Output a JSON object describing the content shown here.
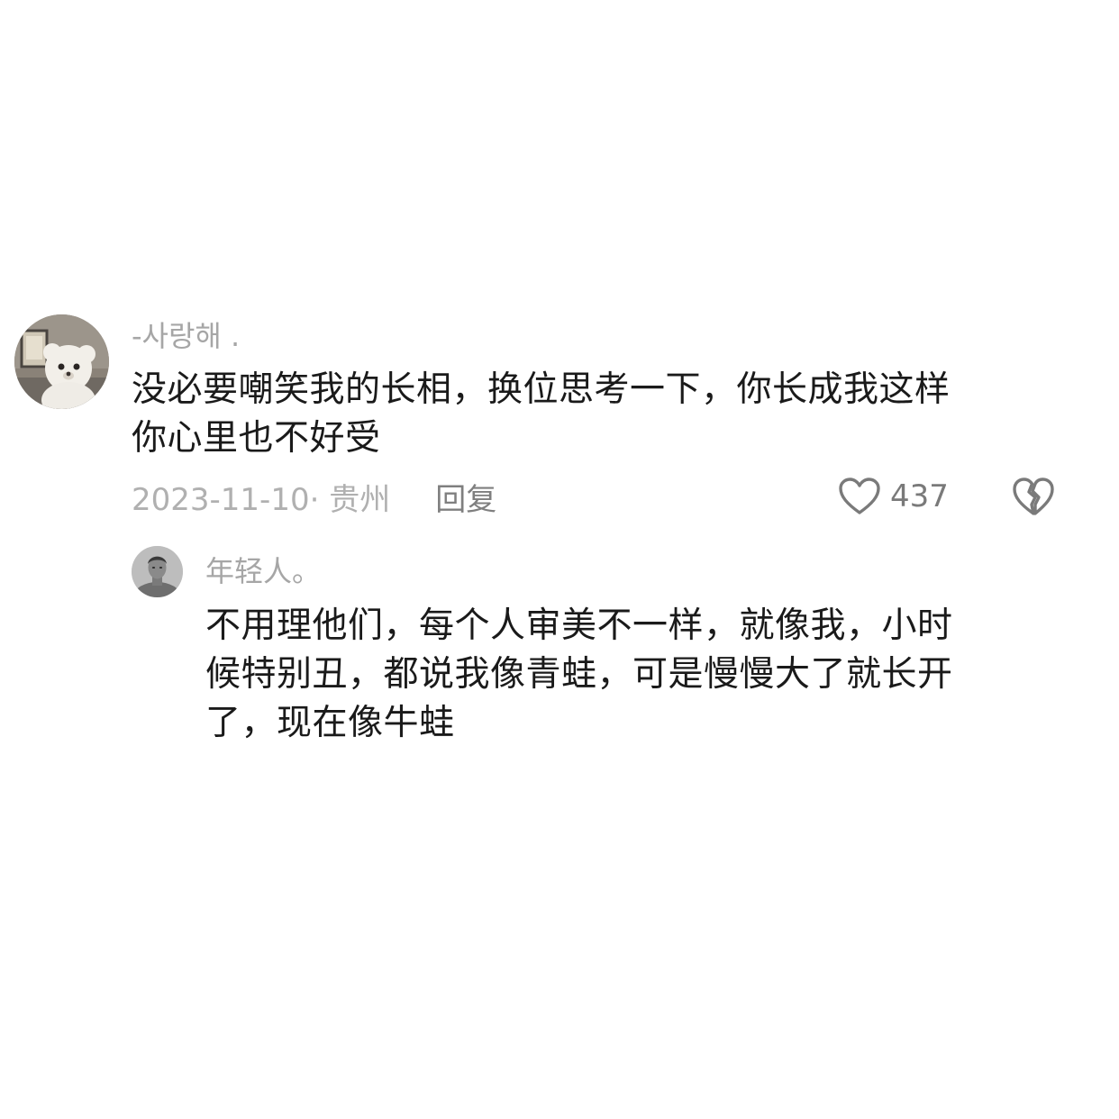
{
  "comment": {
    "avatar_icon": "teddy-bear-avatar",
    "username": "-사랑해 .",
    "lines": [
      "没必要嘲笑我的长相，换位思考一下，你长成我这样",
      "你心里也不好受"
    ],
    "date_location": "2023-11-10· 贵州",
    "reply_label": "回复",
    "like_icon": "heart-outline-icon",
    "like_count": "437",
    "dislike_icon": "broken-heart-icon"
  },
  "reply": {
    "avatar_icon": "man-portrait-avatar",
    "username": "年轻人。",
    "lines": [
      "不用理他们，每个人审美不一样，就像我，小时",
      "候特别丑，都说我像青蛙，可是慢慢大了就长开",
      "了，现在像牛蛙"
    ]
  },
  "colors": {
    "text": "#1a1a1a",
    "muted": "#a6a6a6",
    "action": "#7f7f7f"
  }
}
